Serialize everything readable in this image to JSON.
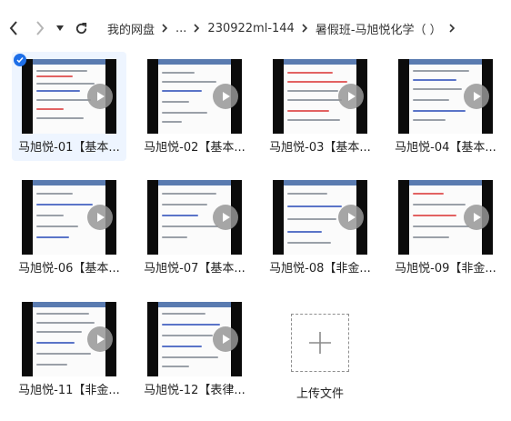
{
  "toolbar": {
    "back_icon": "chevron-left-icon",
    "forward_icon": "chevron-right-icon",
    "dropdown_icon": "caret-down-icon",
    "refresh_icon": "refresh-icon",
    "breadcrumbs": [
      "我的网盘",
      "...",
      "230922ml-144",
      "暑假班-马旭悦化学（ ）"
    ]
  },
  "files": [
    {
      "label": "马旭悦-01【基本...",
      "selected": true
    },
    {
      "label": "马旭悦-02【基本...",
      "selected": false
    },
    {
      "label": "马旭悦-03【基本...",
      "selected": false
    },
    {
      "label": "马旭悦-04【基本...",
      "selected": false
    },
    {
      "label": "马旭悦-06【基本...",
      "selected": false
    },
    {
      "label": "马旭悦-07【基本...",
      "selected": false
    },
    {
      "label": "马旭悦-08【非金...",
      "selected": false
    },
    {
      "label": "马旭悦-09【非金...",
      "selected": false
    },
    {
      "label": "马旭悦-11【非金...",
      "selected": false
    },
    {
      "label": "马旭悦-12【表律...",
      "selected": false
    }
  ],
  "upload": {
    "label": "上传文件",
    "icon": "plus-icon"
  },
  "colors": {
    "accent": "#1e6fe8",
    "selected_bg": "#eef5ff"
  }
}
